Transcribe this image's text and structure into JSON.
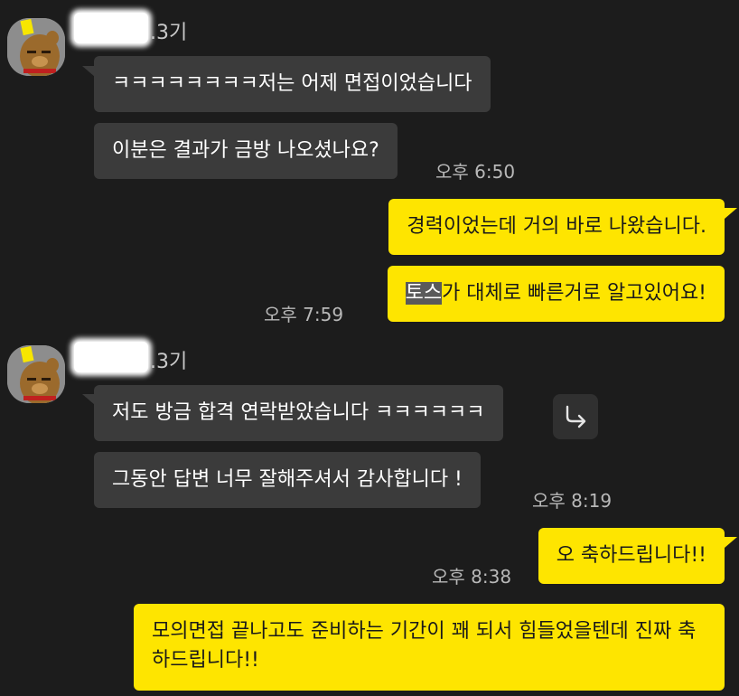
{
  "chat": {
    "sender_name_suffix": ".3기",
    "colors": {
      "background": "#1c1c1c",
      "incoming_bubble": "#3b3b3b",
      "outgoing_bubble": "#fee500"
    },
    "group1": {
      "messages": [
        "ㅋㅋㅋㅋㅋㅋㅋㅋ저는 어제 면접이었습니다",
        "이분은 결과가 금방 나오셨나요?"
      ],
      "time": "오후 6:50"
    },
    "group2": {
      "messages": [
        "경력이었는데 거의 바로 나왔습니다.",
        {
          "highlight": "토스",
          "rest": "가 대체로 빠른거로 알고있어요!"
        }
      ],
      "time": "오후 7:59"
    },
    "group3": {
      "messages": [
        "저도 방금 합격 연락받았습니다 ㅋㅋㅋㅋㅋㅋ",
        "그동안 답변 너무 잘해주셔서 감사합니다 !"
      ],
      "time": "오후 8:19"
    },
    "group4": {
      "messages": [
        "오 축하드립니다!!"
      ],
      "time": "오후 8:38"
    },
    "group5": {
      "messages": [
        "모의면접 끝나고도 준비하는 기간이 꽤 되서 힘들었을텐데 진짜 축하드립니다!!"
      ]
    },
    "icons": {
      "avatar": "avatar-icon",
      "share": "share-icon"
    }
  }
}
